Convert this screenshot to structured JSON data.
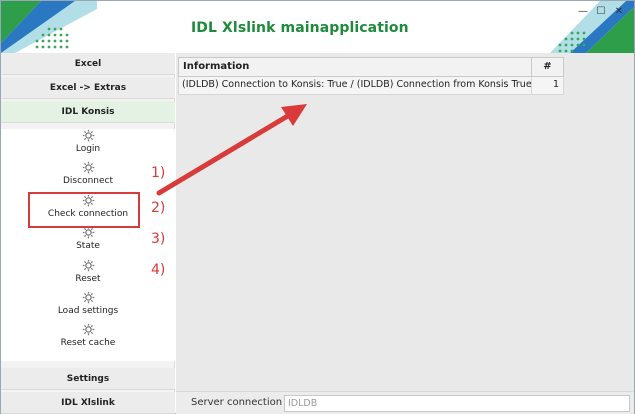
{
  "window": {
    "title": "IDL Xlslink mainapplication",
    "controls": {
      "minimize": "—",
      "maximize": "☐",
      "close": "✕"
    }
  },
  "sidebar": {
    "sections": {
      "excel": "Excel",
      "excel_extras": "Excel -> Extras",
      "idl_konsis": "IDL Konsis",
      "settings": "Settings",
      "idl_xlslink": "IDL Xlslink"
    },
    "items": [
      {
        "label": "Login",
        "icon": "gear-icon"
      },
      {
        "label": "Disconnect",
        "icon": "gear-icon"
      },
      {
        "label": "Check connection",
        "icon": "gear-icon"
      },
      {
        "label": "State",
        "icon": "gear-icon"
      },
      {
        "label": "Reset",
        "icon": "gear-icon"
      },
      {
        "label": "Load settings",
        "icon": "gear-icon"
      },
      {
        "label": "Reset cache",
        "icon": "gear-icon"
      }
    ]
  },
  "grid": {
    "columns": [
      "Information",
      "#"
    ],
    "rows": [
      {
        "information": "(IDLDB) Connection to Konsis: True / (IDLDB) Connection from Konsis True",
        "num": "1"
      }
    ]
  },
  "bottom": {
    "server_label": "Server connection",
    "server_value": "IDLDB"
  },
  "annotations": [
    "1)",
    "2)",
    "3)",
    "4)"
  ],
  "colors": {
    "title_green": "#1e8a3c",
    "annotation_red": "#d93a3a",
    "active_section": "#e4f2e4"
  }
}
